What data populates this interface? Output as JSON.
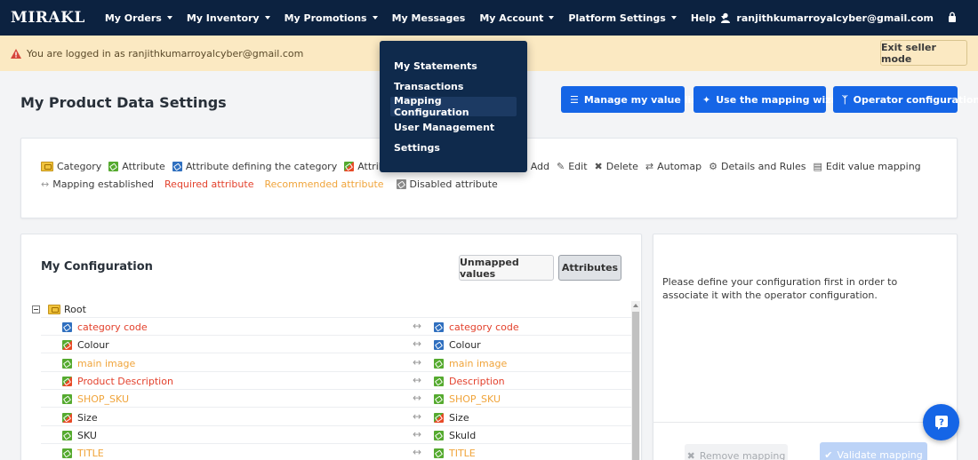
{
  "nav": {
    "logo": "MIRAKL",
    "items": [
      {
        "label": "My Orders",
        "caret": true
      },
      {
        "label": "My Inventory",
        "caret": true
      },
      {
        "label": "My Promotions",
        "caret": true
      },
      {
        "label": "My Messages",
        "caret": false
      },
      {
        "label": "My Account",
        "caret": true
      },
      {
        "label": "Platform Settings",
        "caret": true
      },
      {
        "label": "Help",
        "caret": true
      }
    ],
    "user_email": "ranjithkumarroyalcyber@gmail.com"
  },
  "warning": {
    "text": "You are logged in as ranjithkumarroyalcyber@gmail.com",
    "exit_label": "Exit seller mode"
  },
  "dropdown": {
    "items": [
      {
        "label": "My Statements",
        "active": false
      },
      {
        "label": "Transactions",
        "active": false
      },
      {
        "label": "Mapping Configuration",
        "active": true
      },
      {
        "label": "User Management",
        "active": false
      },
      {
        "label": "Settings",
        "active": false
      }
    ]
  },
  "page": {
    "title": "My Product Data Settings",
    "buttons": {
      "manage": "Manage my value lists",
      "wizard": "Use the mapping wizard",
      "operator": "Operator configuration"
    }
  },
  "legend": {
    "category": "Category",
    "attribute": "Attribute",
    "attr_defining": "Attribute defining the category",
    "attr_with": "Attribute wi",
    "add": "Add",
    "edit": "Edit",
    "delete": "Delete",
    "automap": "Automap",
    "details": "Details and Rules",
    "edit_value_mapping": "Edit value mapping",
    "mapping_established": "Mapping established",
    "required": "Required attribute",
    "recommended": "Recommended attribute",
    "disabled": "Disabled attribute"
  },
  "config": {
    "title": "My Configuration",
    "tab_unmapped": "Unmapped values",
    "tab_attributes": "Attributes",
    "root_label": "Root",
    "rows": [
      {
        "left": "category code",
        "left_style": "red",
        "left_icon": "blue",
        "right": "category code",
        "right_style": "red",
        "right_icon": "blue"
      },
      {
        "left": "Colour",
        "left_style": "normal",
        "left_icon": "mixed",
        "right": "Colour",
        "right_style": "normal",
        "right_icon": "blue"
      },
      {
        "left": "main image",
        "left_style": "orange",
        "left_icon": "green",
        "right": "main image",
        "right_style": "orange",
        "right_icon": "green"
      },
      {
        "left": "Product Description",
        "left_style": "red",
        "left_icon": "mixed",
        "right": "Description",
        "right_style": "red",
        "right_icon": "green"
      },
      {
        "left": "SHOP_SKU",
        "left_style": "orange",
        "left_icon": "green",
        "right": "SHOP_SKU",
        "right_style": "orange",
        "right_icon": "green"
      },
      {
        "left": "Size",
        "left_style": "normal",
        "left_icon": "mixed",
        "right": "Size",
        "right_style": "normal",
        "right_icon": "mixed"
      },
      {
        "left": "SKU",
        "left_style": "normal",
        "left_icon": "green",
        "right": "SkuId",
        "right_style": "normal",
        "right_icon": "green"
      },
      {
        "left": "TITLE",
        "left_style": "orange",
        "left_icon": "green",
        "right": "TITLE",
        "right_style": "orange",
        "right_icon": "green"
      }
    ]
  },
  "right_panel": {
    "message": "Please define your configuration first in order to associate it with the operator configuration.",
    "remove_label": "Remove mapping",
    "validate_label": "Validate mapping"
  },
  "colors": {
    "nav_bg": "#0c2240",
    "primary": "#1565e6",
    "warning_bg": "#fbe9c2",
    "required": "#e3412c",
    "recommended": "#f0a43a"
  }
}
